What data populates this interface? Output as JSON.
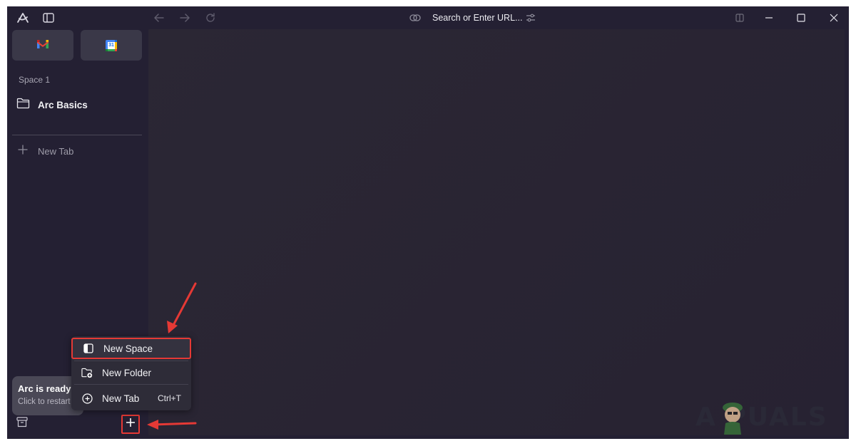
{
  "browser": {
    "address_placeholder": "Search or Enter URL..."
  },
  "favorites": [
    {
      "name": "Gmail",
      "icon": "gmail-icon"
    },
    {
      "name": "Google Calendar",
      "icon": "calendar-icon",
      "badge": "31"
    }
  ],
  "sidebar": {
    "space_name": "Space 1",
    "folder_label": "Arc Basics",
    "new_tab_label": "New Tab",
    "update_title": "Arc is ready",
    "update_subtitle": "Click to restart"
  },
  "menu": {
    "items": [
      {
        "label": "New Space",
        "icon": "sidebar-panel-icon",
        "shortcut": ""
      },
      {
        "label": "New Folder",
        "icon": "new-folder-icon",
        "shortcut": ""
      },
      {
        "label": "New Tab",
        "icon": "circle-plus-icon",
        "shortcut": "Ctrl+T"
      }
    ]
  },
  "watermark": {
    "text": "A  PUALS"
  },
  "colors": {
    "sidebar_bg": "#242033",
    "content_bg": "#2a2633",
    "menu_bg": "#2e2c38",
    "highlight": "#e53935"
  }
}
